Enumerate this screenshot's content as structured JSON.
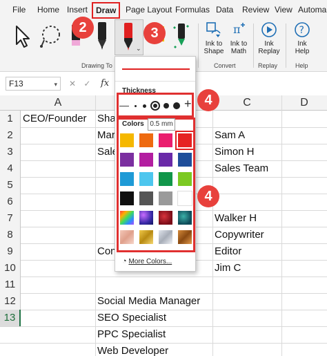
{
  "menu": {
    "items": [
      "File",
      "Home",
      "Insert",
      "Draw",
      "Page Layout",
      "Formulas",
      "Data",
      "Review",
      "View",
      "Automa"
    ]
  },
  "ribbon": {
    "buttons": {
      "ink_to_shape": "Ink to\nShape",
      "ink_to_math": "Ink to\nMath",
      "ink_replay": "Ink\nReplay",
      "ink_help": "Ink\nHelp"
    },
    "groups": {
      "drawing_tools": "Drawing To",
      "convert": "Convert",
      "replay": "Replay",
      "help": "Help"
    }
  },
  "badges": [
    "2",
    "3",
    "4",
    "4"
  ],
  "formula_bar": {
    "namebox": "F13",
    "cancel": "✕",
    "enter": "✓",
    "fx": "fx"
  },
  "grid": {
    "columns": [
      "A",
      "B",
      "C",
      "D"
    ],
    "rows": [
      "1",
      "2",
      "3",
      "4",
      "5",
      "6",
      "7",
      "8",
      "9",
      "10",
      "11",
      "12",
      "13"
    ],
    "selected_row": "13",
    "cells": {
      "a1": "CEO/Founder",
      "b1": "Sha",
      "b2": "Mar",
      "b3": "Sale",
      "b7": "Con",
      "b10": "Social Media Manager",
      "b11": "SEO Specialist",
      "b12": "PPC Specialist",
      "b13": "Web Developer",
      "c2": "Sam A",
      "c3": "Simon H",
      "c4": "Sales Team",
      "c7": "Walker H",
      "c8": "Copywriter",
      "c9": "Editor",
      "c10": "Jim C"
    }
  },
  "dropdown": {
    "thickness_label": "Thickness",
    "colors_label": "Colors",
    "tooltip": "0.5 mm",
    "more_colors": "More Colors...",
    "pen_color": "#e02020",
    "swatches": [
      [
        "#f5b800",
        "#ee6a10",
        "#ea1e6e",
        "#e62222"
      ],
      [
        "#7b2fa0",
        "#b31ea0",
        "#6a2aa8",
        "#1f4e9a"
      ],
      [
        "#1e9ad6",
        "#4dc6ee",
        "#11964a",
        "#7cc922"
      ],
      [
        "#101010",
        "#555555",
        "#9a9a9a",
        "#ffffff"
      ],
      [
        "rainbow",
        "galaxy",
        "ruby",
        "ocean"
      ],
      [
        "rosegold",
        "gold",
        "silver",
        "bronze"
      ]
    ]
  }
}
